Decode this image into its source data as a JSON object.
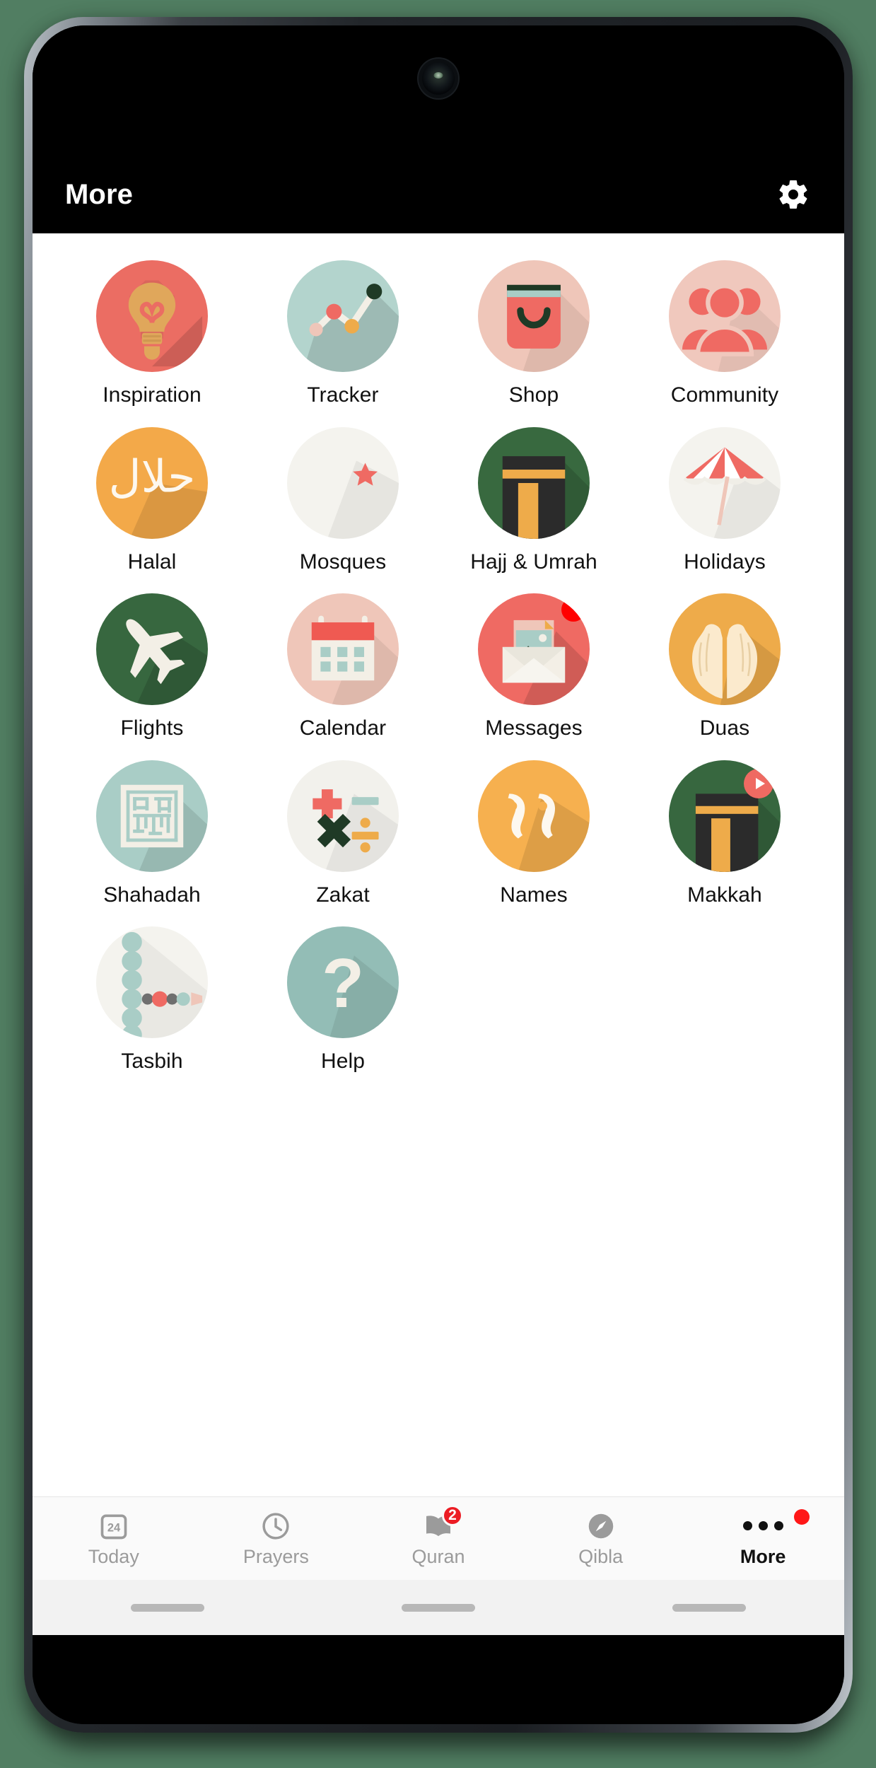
{
  "header": {
    "title": "More",
    "settings_icon": "gear-icon"
  },
  "grid": {
    "items": [
      {
        "label": "Inspiration",
        "icon": "lightbulb-icon",
        "bg": "#eb6d63",
        "badge": null
      },
      {
        "label": "Tracker",
        "icon": "line-chart-icon",
        "bg": "#b3d4cd",
        "badge": null
      },
      {
        "label": "Shop",
        "icon": "shopping-bag-icon",
        "bg": "#efc6b9",
        "badge": null
      },
      {
        "label": "Community",
        "icon": "people-group-icon",
        "bg": "#f0c8bd",
        "badge": null
      },
      {
        "label": "Halal",
        "icon": "halal-arabic-icon",
        "bg": "#f3a949",
        "badge": null
      },
      {
        "label": "Mosques",
        "icon": "crescent-star-icon",
        "bg": "#f4f3ee",
        "badge": null
      },
      {
        "label": "Hajj & Umrah",
        "icon": "kaaba-icon",
        "bg": "#38693f",
        "badge": null
      },
      {
        "label": "Holidays",
        "icon": "beach-umbrella-icon",
        "bg": "#f4f3ee",
        "badge": null
      },
      {
        "label": "Flights",
        "icon": "airplane-icon",
        "bg": "#37673f",
        "badge": null
      },
      {
        "label": "Calendar",
        "icon": "calendar-icon",
        "bg": "#efc6b9",
        "badge": null
      },
      {
        "label": "Messages",
        "icon": "envelope-photo-icon",
        "bg": "#ef6a63",
        "badge": "dot"
      },
      {
        "label": "Duas",
        "icon": "praying-hands-icon",
        "bg": "#eeab4a",
        "badge": null
      },
      {
        "label": "Shahadah",
        "icon": "kufic-square-icon",
        "bg": "#a9cdc6",
        "badge": null
      },
      {
        "label": "Zakat",
        "icon": "calculator-ops-icon",
        "bg": "#f2f1ec",
        "badge": null
      },
      {
        "label": "Names",
        "icon": "ninety-nine-icon",
        "bg": "#f6b04f",
        "badge": null
      },
      {
        "label": "Makkah",
        "icon": "kaaba-live-icon",
        "bg": "#37673f",
        "badge": "play"
      },
      {
        "label": "Tasbih",
        "icon": "prayer-beads-icon",
        "bg": "#f4f3ee",
        "badge": null
      },
      {
        "label": "Help",
        "icon": "question-mark-icon",
        "bg": "#93bdb6",
        "badge": null
      }
    ]
  },
  "tabbar": {
    "tabs": [
      {
        "label": "Today",
        "icon": "calendar-24-icon",
        "active": false,
        "badge": null,
        "reddot": false
      },
      {
        "label": "Prayers",
        "icon": "clock-icon",
        "active": false,
        "badge": null,
        "reddot": false
      },
      {
        "label": "Quran",
        "icon": "open-book-icon",
        "active": false,
        "badge": "2",
        "reddot": false
      },
      {
        "label": "Qibla",
        "icon": "compass-icon",
        "active": false,
        "badge": null,
        "reddot": false
      },
      {
        "label": "More",
        "icon": "ellipsis-icon",
        "active": true,
        "badge": null,
        "reddot": true
      }
    ],
    "today_icon_number": "24"
  },
  "colors": {
    "accent_red": "#ec1c24",
    "header_bg": "#000000",
    "content_bg": "#ffffff",
    "tabbar_bg": "#fafafa",
    "inactive_tab": "#9b9b9b"
  }
}
